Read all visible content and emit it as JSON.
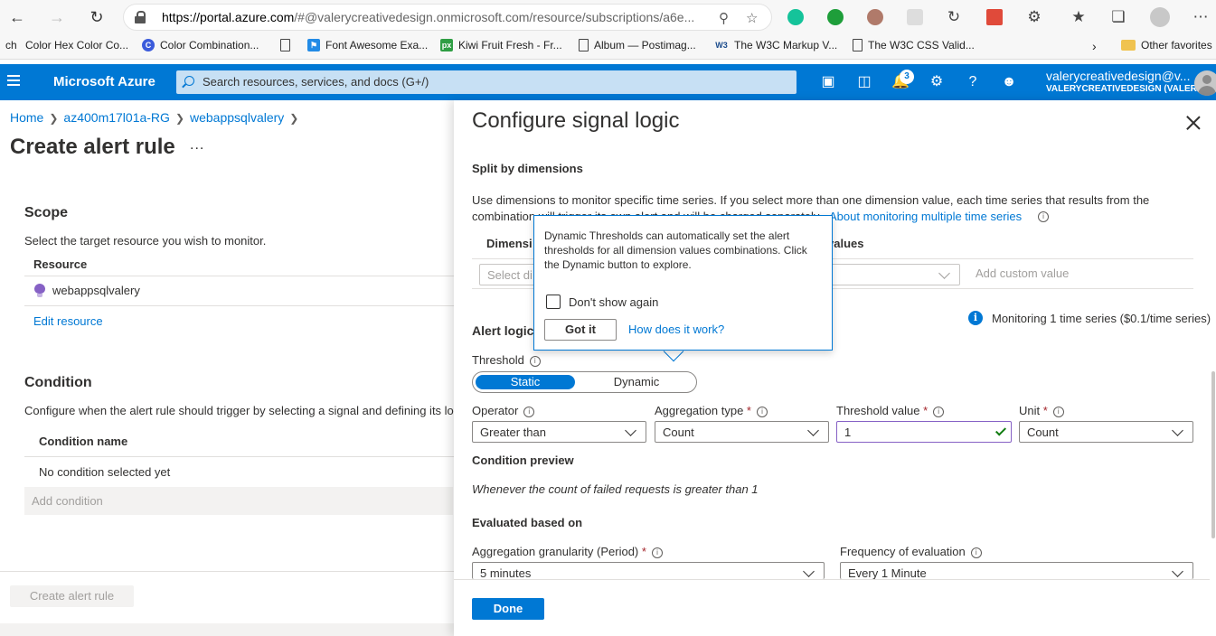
{
  "browser": {
    "url_domain": "https://portal.azure.com",
    "url_rest": "/#@valerycreativedesign.onmicrosoft.com/resource/subscriptions/a6e...",
    "bookmarks": [
      "Color Hex Color Co...",
      "Color Combination...",
      "Font Awesome Exa...",
      "Kiwi Fruit Fresh - Fr...",
      "Album — Postimag...",
      "The W3C Markup V...",
      "The W3C CSS Valid...",
      "Other favorites"
    ],
    "bookmark_prefix": "ch"
  },
  "header": {
    "brand": "Microsoft Azure",
    "search_placeholder": "Search resources, services, and docs (G+/)",
    "notification_count": "3",
    "account_name": "valerycreativedesign@v...",
    "account_tenant": "VALERYCREATIVEDESIGN (VALER..."
  },
  "left": {
    "breadcrumb": [
      "Home",
      "az400m17l01a-RG",
      "webappsqlvalery"
    ],
    "title": "Create alert rule",
    "more": "...",
    "scope": {
      "heading": "Scope",
      "description": "Select the target resource you wish to monitor.",
      "column": "Resource",
      "resource": "webappsqlvalery",
      "edit_link": "Edit resource"
    },
    "condition": {
      "heading": "Condition",
      "description": "Configure when the alert rule should trigger by selecting a signal and defining its lo",
      "column": "Condition name",
      "empty": "No condition selected yet",
      "add": "Add condition"
    },
    "create_button": "Create alert rule"
  },
  "panel": {
    "title": "Configure signal logic",
    "split_heading": "Split by dimensions",
    "split_desc_1": "Use dimensions to monitor specific time series. If you select more than one dimension value, each time series that results from the",
    "split_desc_2": "combination will trigger its own alert and will be charged separately.",
    "split_link": "About monitoring multiple time series",
    "dim_col_1": "Dimensi",
    "dim_col_2": "values",
    "dim_select": "Select di",
    "add_custom": "Add custom value",
    "monitoring_note": "Monitoring 1 time series ($0.1/time series)",
    "alert_logic": "Alert logic",
    "threshold_label": "Threshold",
    "toggle_static": "Static",
    "toggle_dynamic": "Dynamic",
    "operator_label": "Operator",
    "operator_value": "Greater than",
    "agg_type_label": "Aggregation type",
    "agg_type_value": "Count",
    "threshold_value_label": "Threshold value",
    "threshold_value": "1",
    "unit_label": "Unit",
    "unit_value": "Count",
    "preview_heading": "Condition preview",
    "preview_text": "Whenever the count of failed requests is greater than 1",
    "evaluated_heading": "Evaluated based on",
    "granularity_label": "Aggregation granularity (Period)",
    "granularity_value": "5 minutes",
    "frequency_label": "Frequency of evaluation",
    "frequency_value": "Every 1 Minute",
    "done": "Done"
  },
  "callout": {
    "text": "Dynamic Thresholds can automatically set the alert thresholds for all dimension values combinations. Click the Dynamic button to explore.",
    "checkbox_label": "Don't show again",
    "got_it": "Got it",
    "how_link": "How does it work?"
  },
  "colors": {
    "azure_blue": "#0078d4",
    "header_search": "#c7e0f4",
    "required": "#a4262c",
    "valid": "#107c10"
  }
}
